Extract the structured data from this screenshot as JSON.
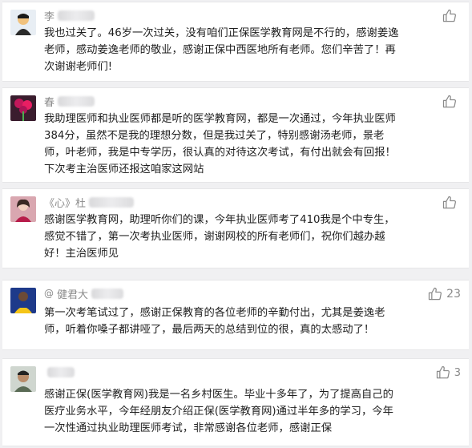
{
  "comments": [
    {
      "name": "李",
      "likes": "",
      "lines": [
        "我也过关了。46岁一次过关，没有咱们正保医学教育网是不行的，感谢姜逸",
        "老师，感动姜逸老师的敬业，感谢正保中西医地所有老师。您们辛苦了！再",
        "次谢谢老师们!"
      ]
    },
    {
      "name": "春",
      "likes": "",
      "lines": [
        "我助理医师和执业医师都是听的医学教育网，都是一次通过，今年执业医师",
        "384分，虽然不是我的理想分数，但是我过关了，特别感谢汤老师，景老",
        "师，叶老师，我是中专学历，很认真的对待这次考试，有付出就会有回报！",
        "下次考主治医师还报这咱家这网站"
      ]
    },
    {
      "name": "《心》杜",
      "likes": "",
      "lines": [
        "感谢医学教育网，助理听你们的课，今年执业医师考了410我是个中专生，",
        "感觉不错了，第一次考执业医师，谢谢网校的所有老师们，祝你们越办越",
        "好！主治医师见"
      ]
    },
    {
      "name": "健君大",
      "name_prefix": "@",
      "likes": "23",
      "lines": [
        "第一次考笔试过了，感谢正保教育的各位老师的辛勤付出，尤其是姜逸老",
        "师，听着你嗓子都讲哑了，最后两天的总结到位的很，真的太感动了！"
      ]
    },
    {
      "name": "",
      "likes": "3",
      "lines": [
        "感谢正保(医学教育网)我是一名乡村医生。毕业十多年了，为了提高自己的",
        "医疗业务水平，今年经朋友介绍正保(医学教育网)通过半年多的学习，今年",
        "一次性通过执业助理医师考试，非常感谢各位老师，感谢正保"
      ]
    }
  ]
}
